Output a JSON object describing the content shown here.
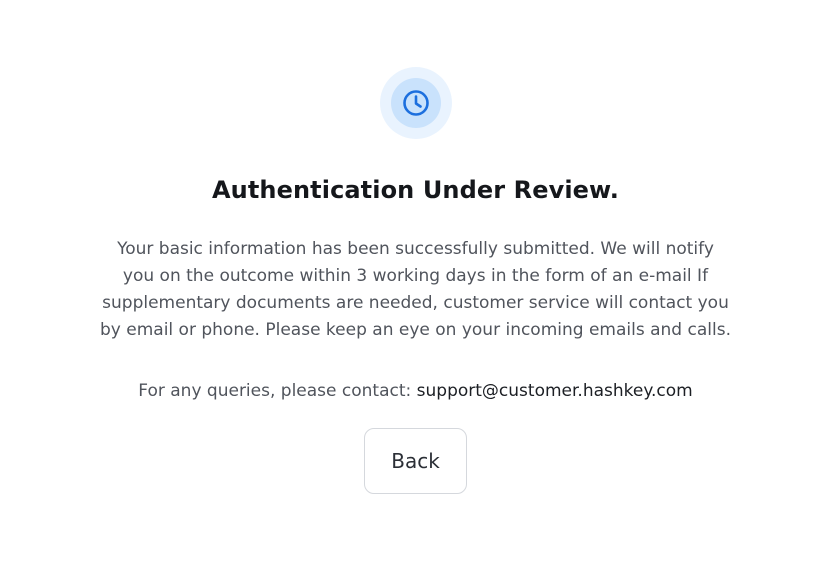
{
  "status": {
    "icon": "clock-icon",
    "accent_color": "#1c6fde",
    "title": "Authentication Under Review.",
    "description": "Your basic information has been successfully submitted. We will notify you on the outcome within 3 working days in the form of an e-mail If supplementary documents are needed, customer service will contact you by email or phone. Please keep an eye on your incoming emails and calls."
  },
  "contact": {
    "prefix": "For any queries, please contact:",
    "email": "support@customer.hashkey.com"
  },
  "actions": {
    "back_label": "Back"
  }
}
